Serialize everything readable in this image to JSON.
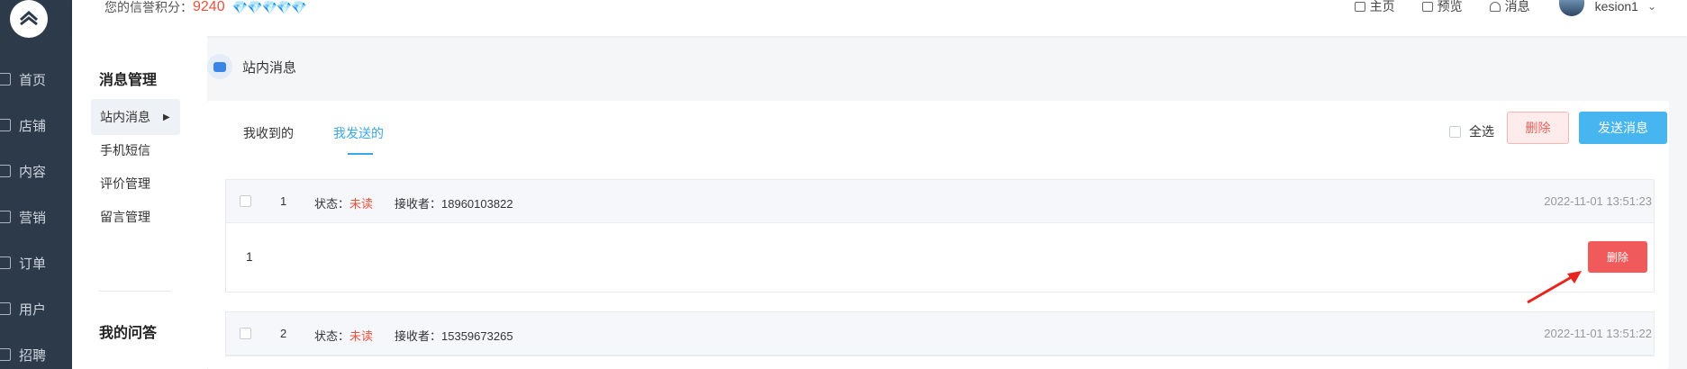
{
  "sidebar": {
    "logo_icon": "logo-icon",
    "items": [
      {
        "label": "首页",
        "icon": "home-icon"
      },
      {
        "label": "店铺",
        "icon": "store-icon"
      },
      {
        "label": "内容",
        "icon": "content-icon"
      },
      {
        "label": "营销",
        "icon": "marketing-icon"
      },
      {
        "label": "订单",
        "icon": "order-icon"
      },
      {
        "label": "用户",
        "icon": "user-icon"
      },
      {
        "label": "招聘",
        "icon": "recruit-icon"
      }
    ]
  },
  "topbar": {
    "credit_label": "您的信誉积分：",
    "credit_value": "9240",
    "diamonds": "💎💎💎💎💎",
    "links": [
      {
        "label": "主页",
        "icon": "home-icon"
      },
      {
        "label": "预览",
        "icon": "monitor-icon"
      },
      {
        "label": "消息",
        "icon": "bell-icon"
      }
    ],
    "username": "kesion1"
  },
  "submenu": {
    "section1_title": "消息管理",
    "items": [
      {
        "label": "站内消息",
        "active": true
      },
      {
        "label": "手机短信"
      },
      {
        "label": "评价管理"
      },
      {
        "label": "留言管理"
      }
    ],
    "section2_title": "我的问答"
  },
  "page": {
    "title": "站内消息",
    "tabs": [
      {
        "label": "我收到的",
        "active": false
      },
      {
        "label": "我发送的",
        "active": true
      }
    ],
    "select_all_label": "全选",
    "delete_label": "删除",
    "send_label": "发送消息"
  },
  "messages": [
    {
      "index": "1",
      "status_label": "状态：",
      "status_value": "未读",
      "receiver_label": "接收者：",
      "receiver": "18960103822",
      "time": "2022-11-01 13:51:23",
      "content": "1",
      "delete_label": "删除"
    },
    {
      "index": "2",
      "status_label": "状态：",
      "status_value": "未读",
      "receiver_label": "接收者：",
      "receiver": "15359673265",
      "time": "2022-11-01 13:51:22"
    }
  ],
  "colors": {
    "sidebar_bg": "#2d3a4a",
    "accent": "#3aa8e8",
    "danger": "#f05a5a",
    "unread": "#e8533f"
  }
}
